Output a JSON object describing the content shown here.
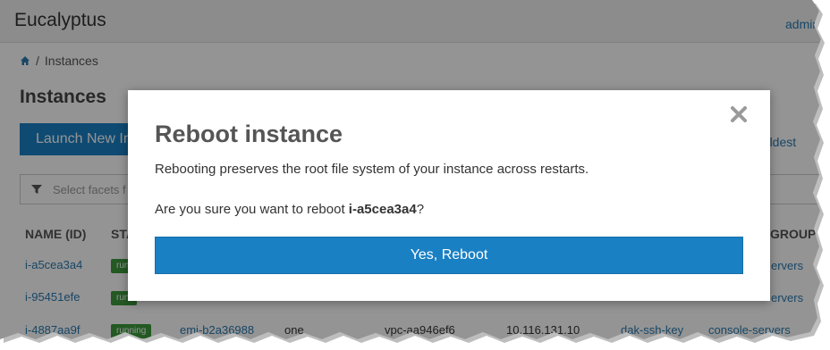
{
  "header": {
    "brand": "Eucalyptus",
    "user": "admin"
  },
  "breadcrumb": {
    "current": "Instances"
  },
  "page": {
    "title": "Instances"
  },
  "toolbar": {
    "launch_label": "Launch New In",
    "sort_label": "o Oldest"
  },
  "facets": {
    "placeholder": "Select facets f"
  },
  "table": {
    "headers": {
      "name": "NAME (ID)",
      "status": "STA",
      "group": "GROUP"
    },
    "rows": [
      {
        "name": "i-a5cea3a4",
        "status": "runi",
        "group": "ervers"
      },
      {
        "name": "i-95451efe",
        "status": "runi",
        "group": "ervers"
      },
      {
        "name": "i-4887aa9f",
        "status": "running",
        "image": "emi-b2a36988",
        "zone": "one",
        "vpc": "vpc-aa946ef6",
        "ip": "10.116.131.10",
        "key": "dak-ssh-key",
        "group": "console-servers"
      }
    ]
  },
  "modal": {
    "title": "Reboot instance",
    "description": "Rebooting preserves the root file system of your instance across restarts.",
    "question_prefix": "Are you sure you want to reboot ",
    "instance_id": "i-a5cea3a4",
    "question_suffix": "?",
    "confirm_label": "Yes, Reboot"
  },
  "colors": {
    "primary": "#1a80c4",
    "link": "#2a7ab0",
    "running": "#3d9a3d"
  }
}
